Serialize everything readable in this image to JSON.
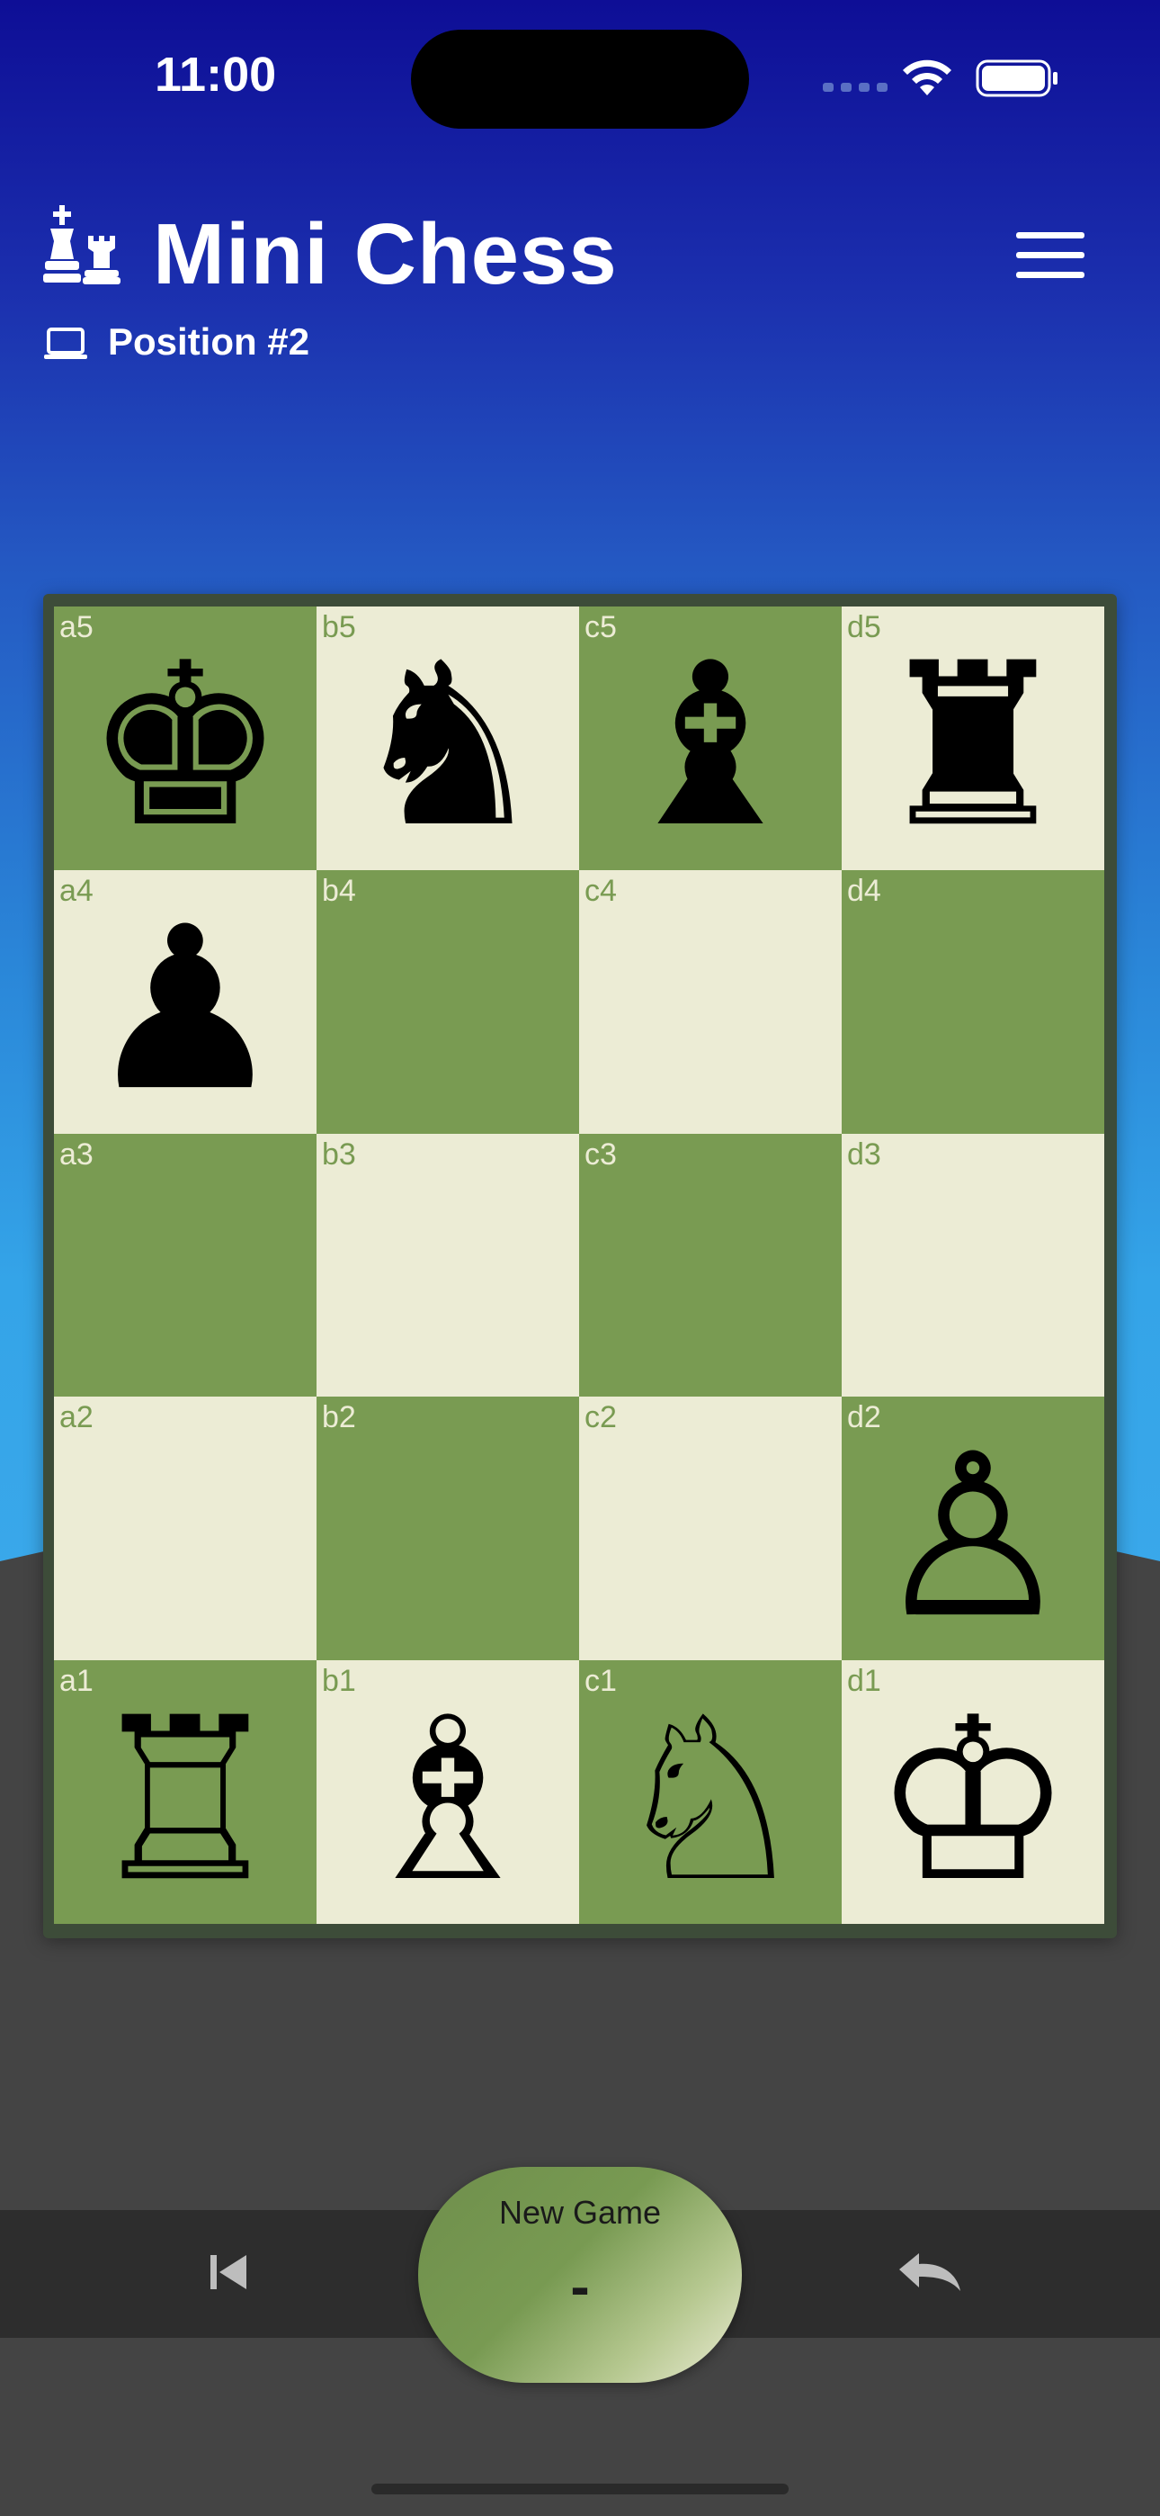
{
  "status_bar": {
    "time": "11:00"
  },
  "header": {
    "title": "Mini Chess",
    "subtitle": "Position #2",
    "icon": "chess-pieces-icon",
    "sub_icon": "laptop-icon",
    "menu_icon": "hamburger-menu-icon"
  },
  "board": {
    "files": [
      "a",
      "b",
      "c",
      "d"
    ],
    "ranks": [
      5,
      4,
      3,
      2,
      1
    ],
    "colors": {
      "dark": "#799b52",
      "light": "#ececd5"
    },
    "squares": [
      {
        "coord": "a5",
        "shade": "dark",
        "piece": "♚",
        "piece_name": "black-king"
      },
      {
        "coord": "b5",
        "shade": "light",
        "piece": "♞",
        "piece_name": "black-knight"
      },
      {
        "coord": "c5",
        "shade": "dark",
        "piece": "♝",
        "piece_name": "black-bishop"
      },
      {
        "coord": "d5",
        "shade": "light",
        "piece": "♜",
        "piece_name": "black-rook"
      },
      {
        "coord": "a4",
        "shade": "light",
        "piece": "♟",
        "piece_name": "black-pawn"
      },
      {
        "coord": "b4",
        "shade": "dark",
        "piece": "",
        "piece_name": ""
      },
      {
        "coord": "c4",
        "shade": "light",
        "piece": "",
        "piece_name": ""
      },
      {
        "coord": "d4",
        "shade": "dark",
        "piece": "",
        "piece_name": ""
      },
      {
        "coord": "a3",
        "shade": "dark",
        "piece": "",
        "piece_name": ""
      },
      {
        "coord": "b3",
        "shade": "light",
        "piece": "",
        "piece_name": ""
      },
      {
        "coord": "c3",
        "shade": "dark",
        "piece": "",
        "piece_name": ""
      },
      {
        "coord": "d3",
        "shade": "light",
        "piece": "",
        "piece_name": ""
      },
      {
        "coord": "a2",
        "shade": "light",
        "piece": "",
        "piece_name": ""
      },
      {
        "coord": "b2",
        "shade": "dark",
        "piece": "",
        "piece_name": ""
      },
      {
        "coord": "c2",
        "shade": "light",
        "piece": "",
        "piece_name": ""
      },
      {
        "coord": "d2",
        "shade": "dark",
        "piece": "♙",
        "piece_name": "white-pawn"
      },
      {
        "coord": "a1",
        "shade": "dark",
        "piece": "♖",
        "piece_name": "white-rook"
      },
      {
        "coord": "b1",
        "shade": "light",
        "piece": "♗",
        "piece_name": "white-bishop"
      },
      {
        "coord": "c1",
        "shade": "dark",
        "piece": "♘",
        "piece_name": "white-knight"
      },
      {
        "coord": "d1",
        "shade": "light",
        "piece": "♔",
        "piece_name": "white-king"
      }
    ]
  },
  "bottom_bar": {
    "new_game_label": "New Game",
    "new_game_value": "-",
    "first_icon": "skip-to-start-icon",
    "undo_icon": "undo-icon"
  }
}
